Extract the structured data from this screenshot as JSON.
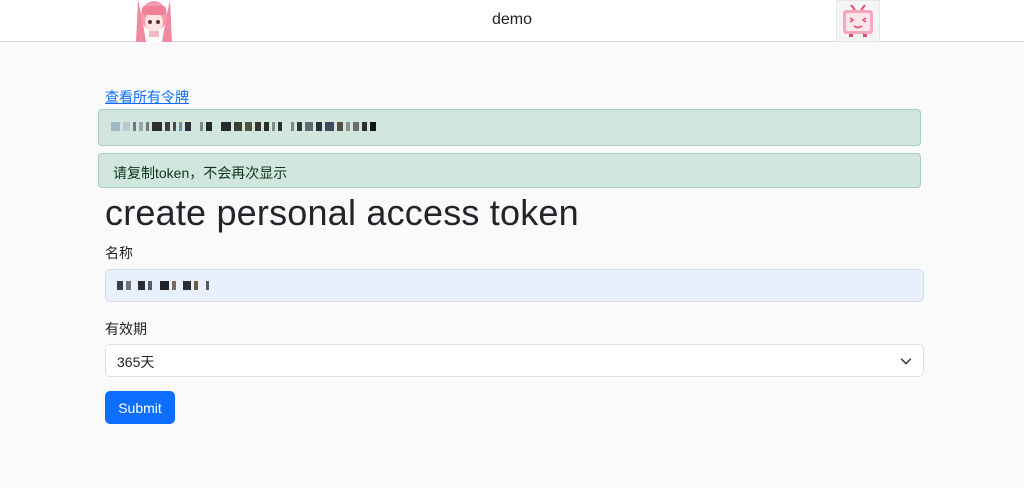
{
  "navbar": {
    "title": "demo",
    "left_avatar_icon": "anime-girl-avatar-icon",
    "right_avatar_icon": "tv-mascot-avatar-icon"
  },
  "main": {
    "back_link": "查看所有令牌",
    "alert_message": "请复制token，不会再次显示",
    "heading": "create personal access token",
    "name_label": "名称",
    "expiry_label": "有效期",
    "expiry_selected": "365天",
    "submit_label": "Submit"
  },
  "colors": {
    "primary": "#0d6efd",
    "alert_bg": "#d1e7dd",
    "alert_border": "#a3cfbb",
    "input_autofill_bg": "#e8f0fe"
  }
}
